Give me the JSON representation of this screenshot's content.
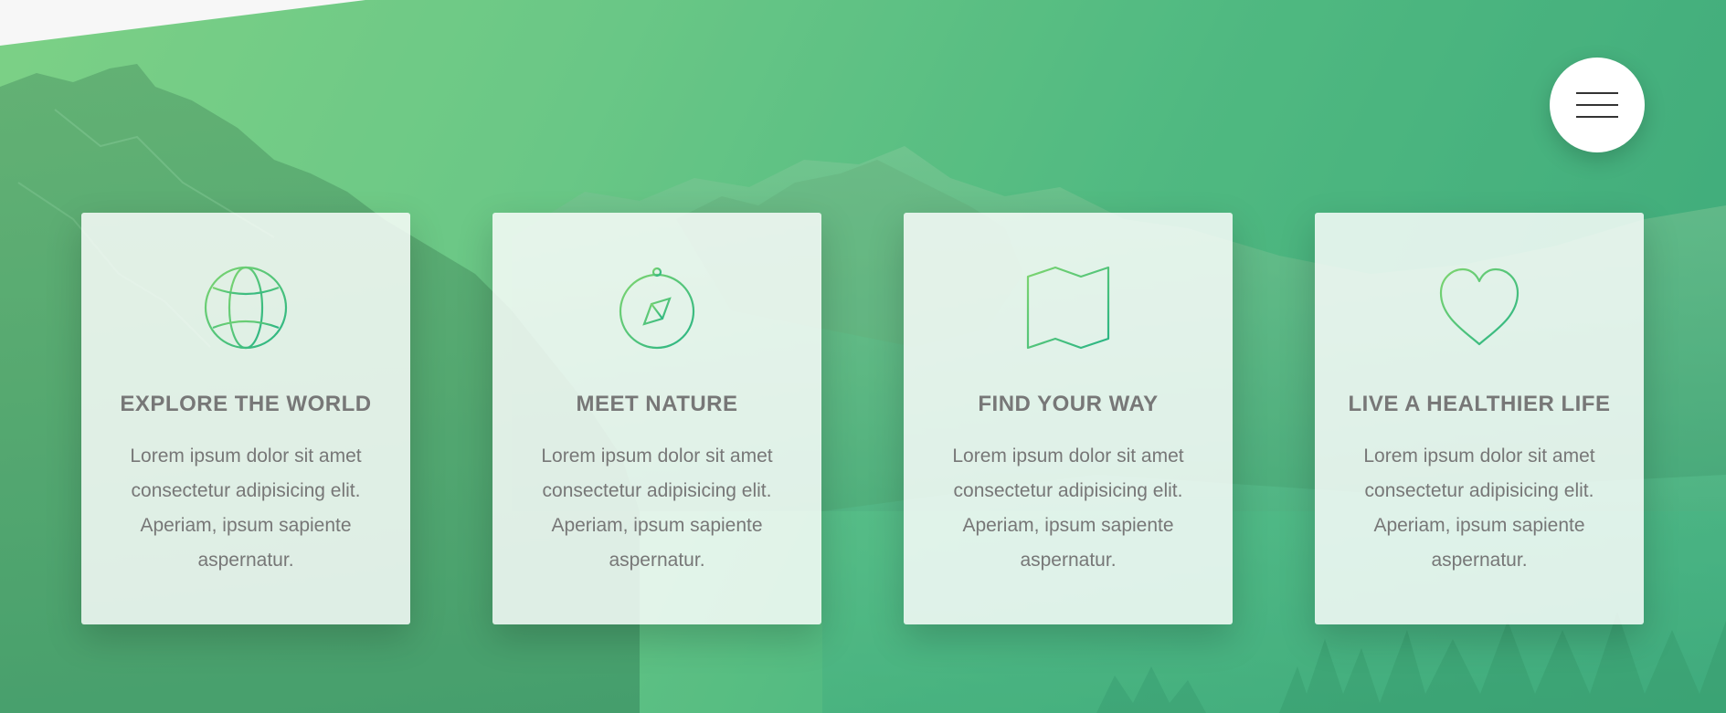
{
  "header": {
    "menu_icon": "hamburger-menu-icon"
  },
  "features": [
    {
      "icon": "globe-icon",
      "title": "EXPLORE THE WORLD",
      "text": "Lorem ipsum dolor sit amet consectetur adipisicing elit. Aperiam, ipsum sapiente aspernatur."
    },
    {
      "icon": "compass-icon",
      "title": "MEET NATURE",
      "text": "Lorem ipsum dolor sit amet consectetur adipisicing elit. Aperiam, ipsum sapiente aspernatur."
    },
    {
      "icon": "map-icon",
      "title": "FIND YOUR WAY",
      "text": "Lorem ipsum dolor sit amet consectetur adipisicing elit. Aperiam, ipsum sapiente aspernatur."
    },
    {
      "icon": "heart-icon",
      "title": "LIVE A HEALTHIER LIFE",
      "text": "Lorem ipsum dolor sit amet consectetur adipisicing elit. Aperiam, ipsum sapiente aspernatur."
    }
  ],
  "colors": {
    "accent_light": "#7ed56f",
    "accent_dark": "#28b485",
    "text": "#777777"
  }
}
